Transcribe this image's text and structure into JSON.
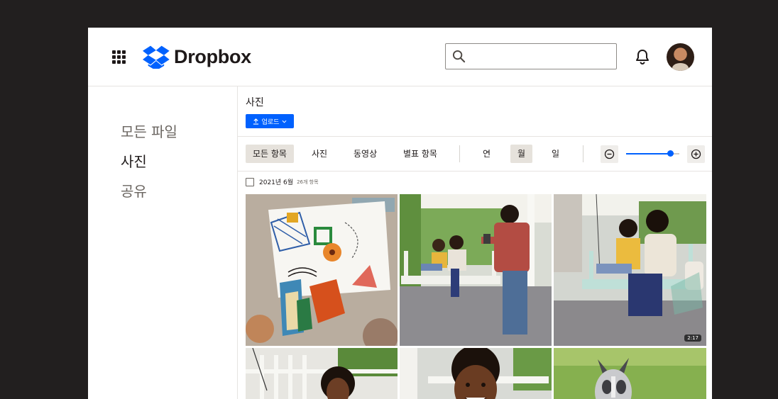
{
  "header": {
    "logo_text": "Dropbox",
    "search_placeholder": "",
    "brand_color": "#0061fe"
  },
  "sidebar": {
    "items": [
      {
        "label": "모든 파일",
        "active": false
      },
      {
        "label": "사진",
        "active": true
      },
      {
        "label": "공유",
        "active": false
      }
    ]
  },
  "main": {
    "title": "사진",
    "upload_label": "업로드",
    "filters": [
      {
        "label": "모든 항목",
        "selected": true
      },
      {
        "label": "사진",
        "selected": false
      },
      {
        "label": "동영상",
        "selected": false
      },
      {
        "label": "별표 항목",
        "selected": false
      }
    ],
    "periods": [
      {
        "label": "연",
        "selected": false
      },
      {
        "label": "월",
        "selected": true
      },
      {
        "label": "일",
        "selected": false
      }
    ],
    "zoom_level": 0.85,
    "group": {
      "date": "2021년 6월",
      "count": "26개 항목"
    },
    "photos": [
      {
        "name": "photo-colorful-collage",
        "badge": ""
      },
      {
        "name": "photo-man-photographing-family-on-porch-swing",
        "badge": ""
      },
      {
        "name": "photo-mother-and-son-on-porch-swing",
        "badge": "2:17"
      },
      {
        "name": "photo-boy-on-porch-swing",
        "badge": ""
      },
      {
        "name": "photo-smiling-boy-close-up",
        "badge": ""
      },
      {
        "name": "photo-dog-on-grass",
        "badge": ""
      }
    ]
  }
}
